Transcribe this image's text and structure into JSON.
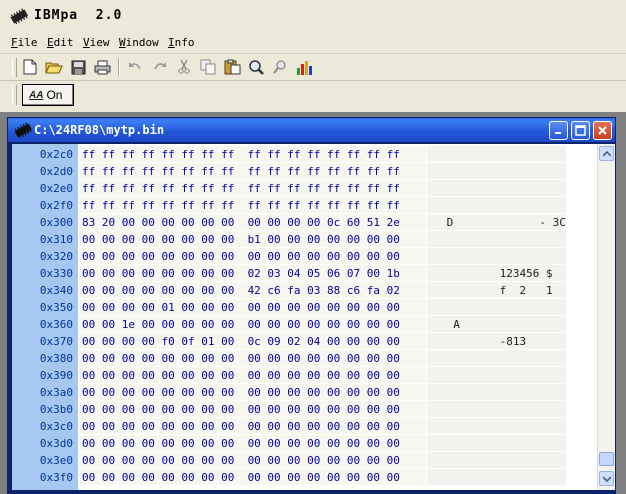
{
  "app": {
    "title": "IBMpa  2.0"
  },
  "menu": {
    "items": [
      {
        "label": "File",
        "underline": "F",
        "rest": "ile"
      },
      {
        "label": "Edit",
        "underline": "E",
        "rest": "dit"
      },
      {
        "label": "View",
        "underline": "V",
        "rest": "iew"
      },
      {
        "label": "Window",
        "underline": "W",
        "rest": "indow"
      },
      {
        "label": "Info",
        "underline": "I",
        "rest": "nfo"
      }
    ]
  },
  "toggle": {
    "label": "On",
    "icon_text": "AA"
  },
  "document": {
    "title": "C:\\24RF08\\mytp.bin"
  },
  "rows": [
    {
      "addr": "0x2c0",
      "hex": "ff ff ff ff ff ff ff ff  ff ff ff ff ff ff ff ff",
      "ascii": ""
    },
    {
      "addr": "0x2d0",
      "hex": "ff ff ff ff ff ff ff ff  ff ff ff ff ff ff ff ff",
      "ascii": ""
    },
    {
      "addr": "0x2e0",
      "hex": "ff ff ff ff ff ff ff ff  ff ff ff ff ff ff ff ff",
      "ascii": ""
    },
    {
      "addr": "0x2f0",
      "hex": "ff ff ff ff ff ff ff ff  ff ff ff ff ff ff ff ff",
      "ascii": ""
    },
    {
      "addr": "0x300",
      "hex": "83 20 00 00 00 00 00 00  00 00 00 00 0c 60 51 2e",
      "ascii": " D             - 3C"
    },
    {
      "addr": "0x310",
      "hex": "00 00 00 00 00 00 00 00  b1 00 00 00 00 00 00 00",
      "ascii": ""
    },
    {
      "addr": "0x320",
      "hex": "00 00 00 00 00 00 00 00  00 00 00 00 00 00 00 00",
      "ascii": ""
    },
    {
      "addr": "0x330",
      "hex": "00 00 00 00 00 00 00 00  02 03 04 05 06 07 00 1b",
      "ascii": "         123456 $"
    },
    {
      "addr": "0x340",
      "hex": "00 00 00 00 00 00 00 00  42 c6 fa 03 88 c6 fa 02",
      "ascii": "         f  2   1"
    },
    {
      "addr": "0x350",
      "hex": "00 00 00 00 01 00 00 00  00 00 00 00 00 00 00 00",
      "ascii": ""
    },
    {
      "addr": "0x360",
      "hex": "00 00 1e 00 00 00 00 00  00 00 00 00 00 00 00 00",
      "ascii": "  A"
    },
    {
      "addr": "0x370",
      "hex": "00 00 00 00 f0 0f 01 00  0c 09 02 04 00 00 00 00",
      "ascii": "         -813"
    },
    {
      "addr": "0x380",
      "hex": "00 00 00 00 00 00 00 00  00 00 00 00 00 00 00 00",
      "ascii": ""
    },
    {
      "addr": "0x390",
      "hex": "00 00 00 00 00 00 00 00  00 00 00 00 00 00 00 00",
      "ascii": ""
    },
    {
      "addr": "0x3a0",
      "hex": "00 00 00 00 00 00 00 00  00 00 00 00 00 00 00 00",
      "ascii": ""
    },
    {
      "addr": "0x3b0",
      "hex": "00 00 00 00 00 00 00 00  00 00 00 00 00 00 00 00",
      "ascii": ""
    },
    {
      "addr": "0x3c0",
      "hex": "00 00 00 00 00 00 00 00  00 00 00 00 00 00 00 00",
      "ascii": ""
    },
    {
      "addr": "0x3d0",
      "hex": "00 00 00 00 00 00 00 00  00 00 00 00 00 00 00 00",
      "ascii": ""
    },
    {
      "addr": "0x3e0",
      "hex": "00 00 00 00 00 00 00 00  00 00 00 00 00 00 00 00",
      "ascii": ""
    },
    {
      "addr": "0x3f0",
      "hex": "00 00 00 00 00 00 00 00  00 00 00 00 00 00 00 00",
      "ascii": ""
    }
  ],
  "colors": {
    "address_bg": "#a6c8f0",
    "address_text": "#003399",
    "hex_text": "#0000a0",
    "title_blue": "#2458d8"
  }
}
